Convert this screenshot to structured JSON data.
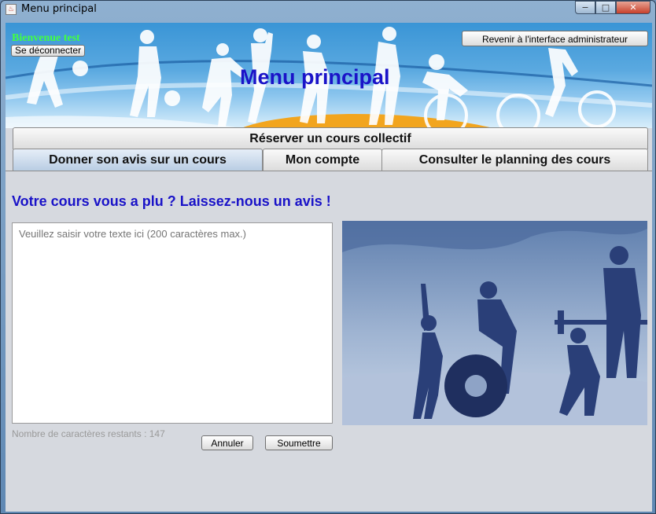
{
  "window": {
    "title": "Menu principal",
    "app_icon": "java-cup-icon",
    "controls": {
      "minimize": "−",
      "maximize": "□",
      "close": "✕"
    }
  },
  "banner": {
    "welcome": "Bienvenue test",
    "logout_label": "Se déconnecter",
    "admin_label": "Revenir à l'interface administrateur",
    "title": "Menu principal"
  },
  "tabs": {
    "row1": "Réserver un cours collectif",
    "row2": [
      "Donner son avis sur un cours",
      "Mon compte",
      "Consulter le planning des cours"
    ],
    "active": "Donner son avis sur un cours"
  },
  "review": {
    "heading": "Votre cours vous a plu ? Laissez-nous un avis !",
    "textarea_value": "",
    "textarea_placeholder": "Veuillez saisir votre texte ici (200 caractères max.)",
    "counter_label": "Nombre de caractères restants : 147",
    "cancel_label": "Annuler",
    "submit_label": "Soumettre"
  },
  "colors": {
    "heading": "#1a13c8",
    "welcome": "#41ff41",
    "background": "#d6d9df"
  }
}
